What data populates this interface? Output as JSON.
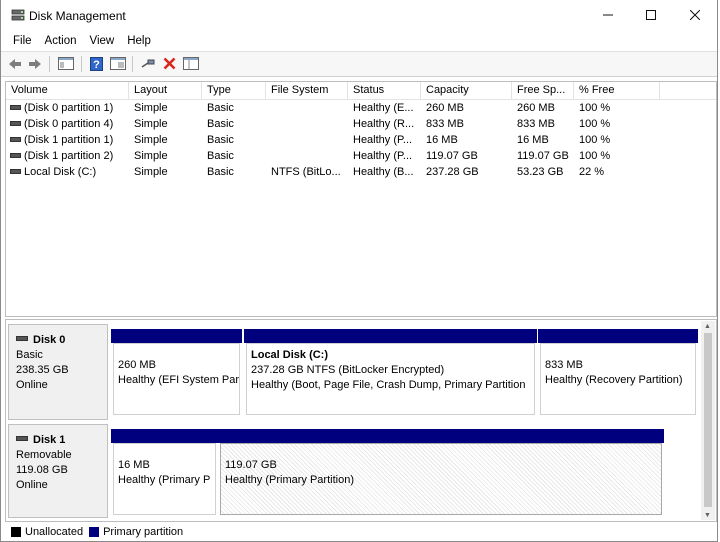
{
  "window": {
    "title": "Disk Management",
    "icon": "disk-management-icon"
  },
  "menu": [
    "File",
    "Action",
    "View",
    "Help"
  ],
  "toolbar": {
    "icons": [
      "back-arrow-icon",
      "forward-arrow-icon",
      "console-tree-icon",
      "help-icon",
      "properties-pane-icon",
      "connect-icon",
      "delete-icon",
      "view-pane-icon"
    ],
    "accent_colors": {
      "delete": "#d9261c",
      "help": "#2e66c9"
    }
  },
  "volume_list": {
    "columns": [
      "Volume",
      "Layout",
      "Type",
      "File System",
      "Status",
      "Capacity",
      "Free Sp...",
      "% Free"
    ],
    "rows": [
      [
        "(Disk 0 partition 1)",
        "Simple",
        "Basic",
        "",
        "Healthy (E...",
        "260 MB",
        "260 MB",
        "100 %"
      ],
      [
        "(Disk 0 partition 4)",
        "Simple",
        "Basic",
        "",
        "Healthy (R...",
        "833 MB",
        "833 MB",
        "100 %"
      ],
      [
        "(Disk 1 partition 1)",
        "Simple",
        "Basic",
        "",
        "Healthy (P...",
        "16 MB",
        "16 MB",
        "100 %"
      ],
      [
        "(Disk 1 partition 2)",
        "Simple",
        "Basic",
        "",
        "Healthy (P...",
        "119.07 GB",
        "119.07 GB",
        "100 %"
      ],
      [
        "Local Disk (C:)",
        "Simple",
        "Basic",
        "NTFS (BitLo...",
        "Healthy (B...",
        "237.28 GB",
        "53.23 GB",
        "22 %"
      ]
    ]
  },
  "disks": [
    {
      "name": "Disk 0",
      "type": "Basic",
      "size": "238.35 GB",
      "status": "Online",
      "partitions": [
        {
          "name": "",
          "size": "260 MB",
          "status": "Healthy (EFI System Par"
        },
        {
          "name": "Local Disk  (C:)",
          "size": "237.28 GB NTFS (BitLocker Encrypted)",
          "status": "Healthy (Boot, Page File, Crash Dump, Primary Partition"
        },
        {
          "name": "",
          "size": "833 MB",
          "status": "Healthy (Recovery Partition)"
        }
      ]
    },
    {
      "name": "Disk 1",
      "type": "Removable",
      "size": "119.08 GB",
      "status": "Online",
      "partitions": [
        {
          "name": "",
          "size": "16 MB",
          "status": "Healthy (Primary P"
        },
        {
          "name": "",
          "size": "119.07 GB",
          "status": "Healthy (Primary Partition)"
        }
      ]
    }
  ],
  "legend": [
    {
      "label": "Unallocated",
      "color": "#000000"
    },
    {
      "label": "Primary partition",
      "color": "#00007f"
    }
  ]
}
